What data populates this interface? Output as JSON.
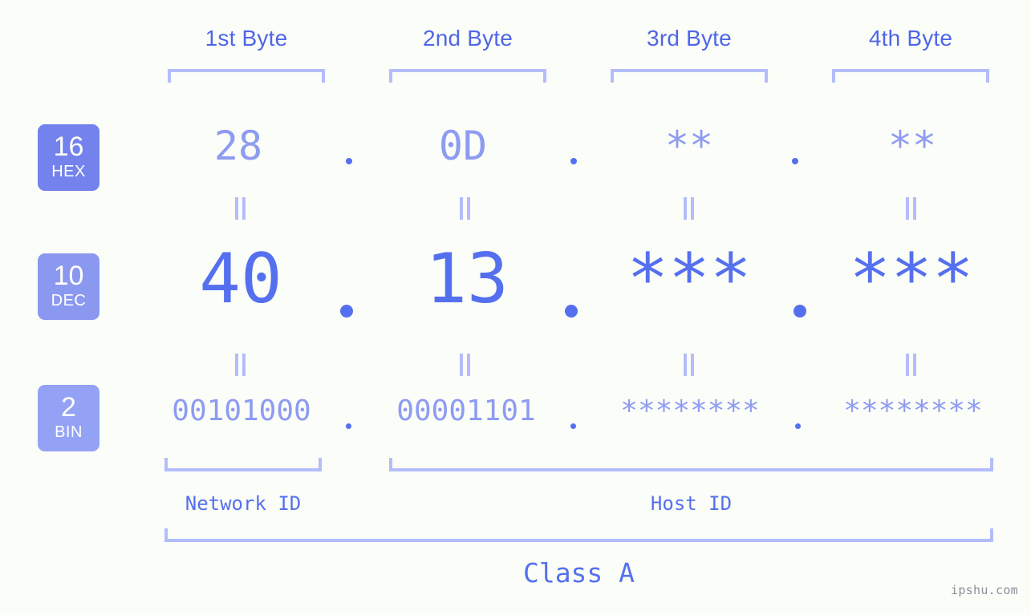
{
  "byte_headers": [
    {
      "label": "1st Byte"
    },
    {
      "label": "2nd Byte"
    },
    {
      "label": "3rd Byte"
    },
    {
      "label": "4th Byte"
    }
  ],
  "bases": [
    {
      "number": "16",
      "name": "HEX",
      "color": "#7382ec"
    },
    {
      "number": "10",
      "name": "DEC",
      "color": "#8b98f0"
    },
    {
      "number": "2",
      "name": "BIN",
      "color": "#93a2f5"
    }
  ],
  "rows": {
    "hex": {
      "octets": [
        "28",
        "0D",
        "**",
        "**"
      ],
      "separator": "."
    },
    "dec": {
      "octets": [
        "40",
        "13",
        "***",
        "***"
      ],
      "separator": "."
    },
    "bin": {
      "octets": [
        "00101000",
        "00001101",
        "********",
        "********"
      ],
      "separator": "."
    }
  },
  "equals_marker": "=",
  "segments": {
    "network_id": "Network ID",
    "host_id": "Host ID",
    "class": "Class A"
  },
  "watermark": "ipshu.com",
  "colors": {
    "background": "#fbfdf8",
    "accent_strong": "#5570ee",
    "accent_mid": "#8d9bf2",
    "accent_light": "#b3bdfb",
    "header_text": "#4f66e8",
    "watermark_text": "#8a8f9c"
  }
}
